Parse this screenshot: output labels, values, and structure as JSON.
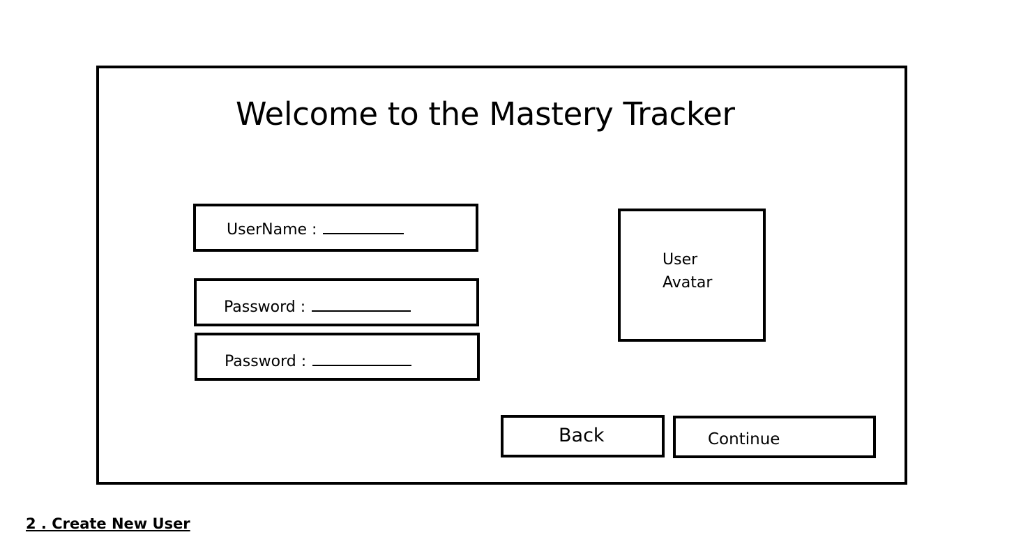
{
  "screen": {
    "title": "Welcome to the Mastery Tracker"
  },
  "form": {
    "username_label": "UserName :",
    "password_label": "Password :",
    "confirm_password_label": "Password :"
  },
  "avatar": {
    "line1": "User",
    "line2": "Avatar"
  },
  "buttons": {
    "back_label": "Back",
    "continue_label": "Continue"
  },
  "caption": {
    "text": "2 . Create New User"
  }
}
